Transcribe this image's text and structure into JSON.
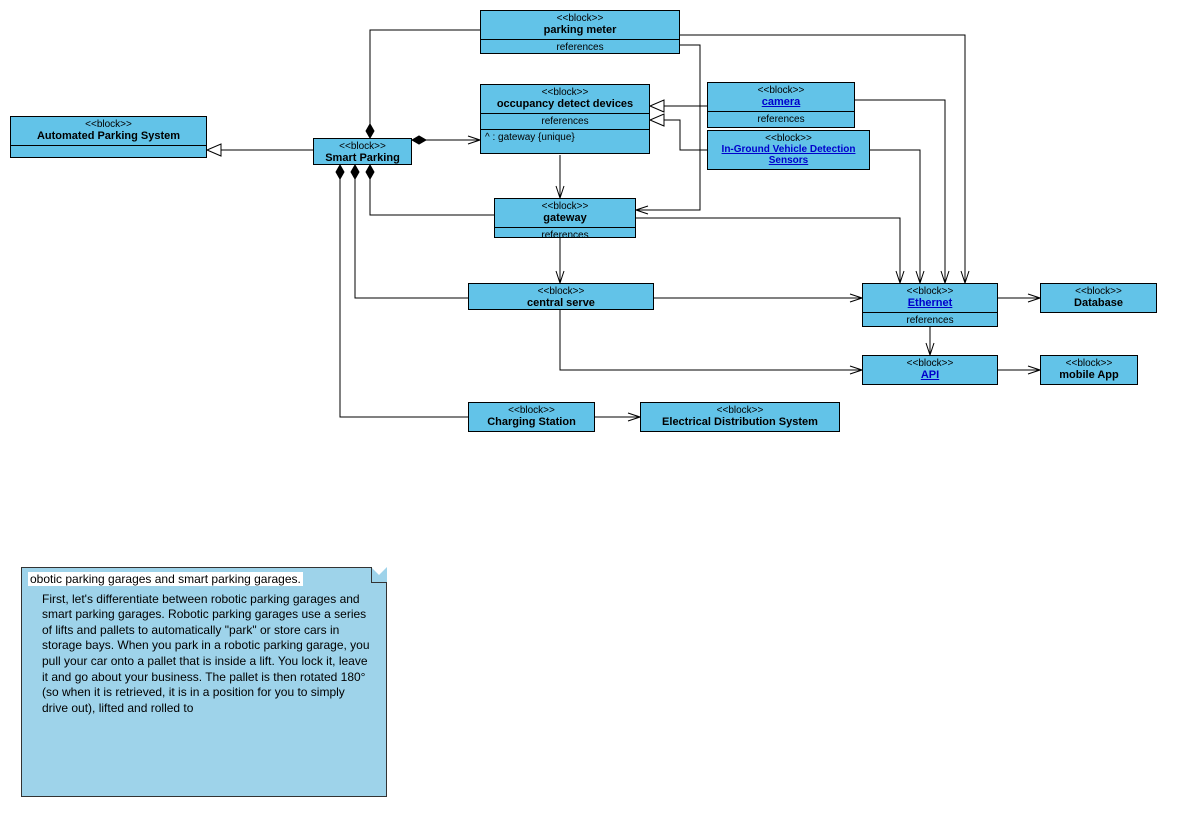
{
  "blocks": {
    "automated": {
      "stereo": "<<block>>",
      "name": "Automated Parking System"
    },
    "smart": {
      "stereo": "<<block>>",
      "name": "Smart Parking"
    },
    "meter": {
      "stereo": "<<block>>",
      "name": "parking meter",
      "ref": "references"
    },
    "occup": {
      "stereo": "<<block>>",
      "name": "occupancy detect devices",
      "ref": "references",
      "prop": "^ : gateway {unique}"
    },
    "camera": {
      "stereo": "<<block>>",
      "name": "camera",
      "ref": "references"
    },
    "inground": {
      "stereo": "<<block>>",
      "name": "In-Ground Vehicle Detection Sensors"
    },
    "gateway": {
      "stereo": "<<block>>",
      "name": "gateway",
      "ref": "references"
    },
    "central": {
      "stereo": "<<block>>",
      "name": "central serve"
    },
    "ethernet": {
      "stereo": "<<block>>",
      "name": "Ethernet",
      "ref": "references"
    },
    "database": {
      "stereo": "<<block>>",
      "name": "Database"
    },
    "api": {
      "stereo": "<<block>>",
      "name": "API"
    },
    "mobile": {
      "stereo": "<<block>>",
      "name": "mobile App"
    },
    "charging": {
      "stereo": "<<block>>",
      "name": "Charging Station"
    },
    "electrical": {
      "stereo": "<<block>>",
      "name": "Electrical Distribution System"
    }
  },
  "note": {
    "title": "obotic parking garages and smart parking garages.",
    "body": "First, let's differentiate between robotic parking garages and smart parking garages. Robotic parking garages use a series of lifts and pallets to automatically \"park\" or store cars in storage bays. When you park in a robotic parking garage, you pull your car onto a pallet that is inside a lift. You lock it, leave it and go about your business. The pallet is then rotated 180° (so when it is retrieved, it is in a position for you to simply drive out), lifted and rolled to"
  }
}
